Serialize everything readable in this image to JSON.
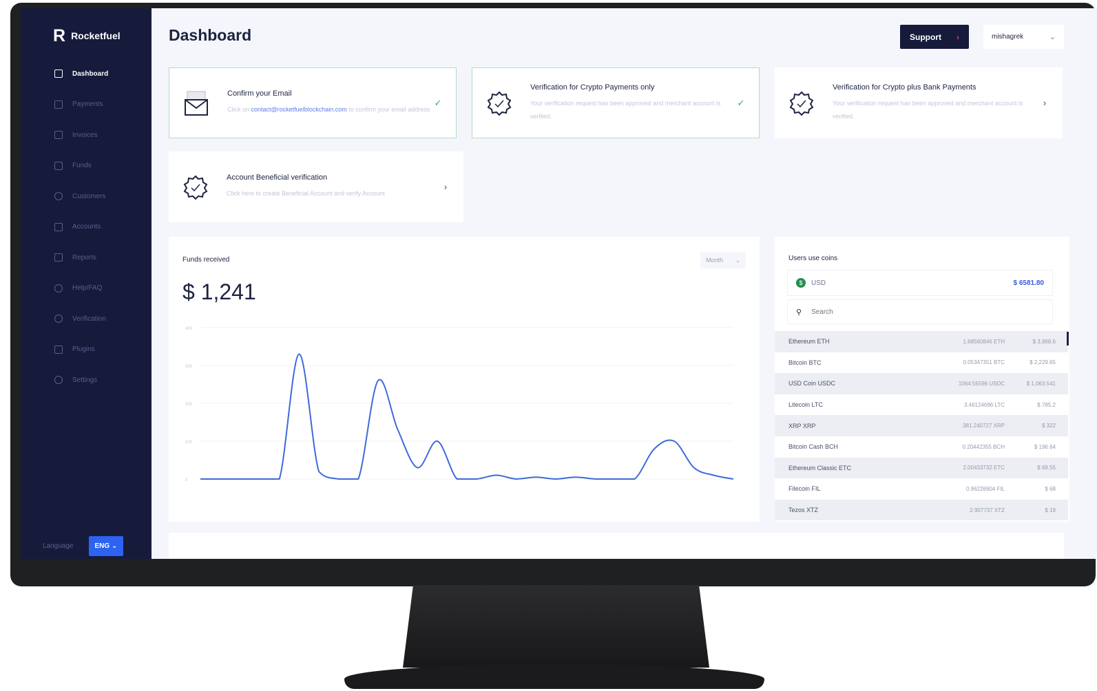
{
  "brand": {
    "name": "Rocketfuel",
    "mark": "R"
  },
  "sidebar": {
    "items": [
      {
        "label": "Dashboard",
        "icon": "grid-icon",
        "active": true
      },
      {
        "label": "Payments",
        "icon": "payments-icon",
        "active": false
      },
      {
        "label": "Invoices",
        "icon": "invoices-icon",
        "active": false
      },
      {
        "label": "Funds",
        "icon": "funds-icon",
        "active": false
      },
      {
        "label": "Customers",
        "icon": "customers-icon",
        "active": false
      },
      {
        "label": "Accounts",
        "icon": "accounts-icon",
        "active": false
      },
      {
        "label": "Reports",
        "icon": "reports-icon",
        "active": false
      },
      {
        "label": "Help/FAQ",
        "icon": "help-icon",
        "active": false
      },
      {
        "label": "Verification",
        "icon": "verification-icon",
        "active": false
      },
      {
        "label": "Plugins",
        "icon": "plugins-icon",
        "active": false
      },
      {
        "label": "Settings",
        "icon": "gear-icon",
        "active": false
      }
    ],
    "language_label": "Language",
    "language_value": "ENG"
  },
  "header": {
    "title": "Dashboard",
    "support_label": "Support",
    "user_name": "mishagrek"
  },
  "verification_cards": [
    {
      "title": "Confirm your Email",
      "desc_prefix": "Click on ",
      "desc_link": "contact@rocketfuelblockchain.com",
      "desc_suffix": " to confirm your email address",
      "status": "check"
    },
    {
      "title": "Verification for Crypto Payments only",
      "desc": "Your verification request has been approved and merchant account is verified.",
      "status": "check"
    },
    {
      "title": "Verification for Crypto plus Bank Payments",
      "desc": "Your verification request has been approved and merchant account is verified.",
      "status": "next"
    },
    {
      "title": "Account Beneficial verification",
      "desc": "Click here to create Beneficial Account and verify Account",
      "status": "next"
    }
  ],
  "funds": {
    "title": "Funds received",
    "period": "Month",
    "total": "$ 1,241"
  },
  "coins_panel": {
    "title": "Users use coins",
    "usd_label": "USD",
    "usd_value": "$ 6581.80",
    "search_placeholder": "Search",
    "rows": [
      {
        "name": "Ethereum ETH",
        "amount": "1.68560846 ETH",
        "usd": "$ 3,968.6"
      },
      {
        "name": "Bitcoin BTC",
        "amount": "0.05347351 BTC",
        "usd": "$ 2,229.65"
      },
      {
        "name": "USD Coin USDC",
        "amount": "1064.55596 USDC",
        "usd": "$ 1,063.541"
      },
      {
        "name": "Litecoin LTC",
        "amount": "3.46124696 LTC",
        "usd": "$ 785.2"
      },
      {
        "name": "XRP XRP",
        "amount": "381.240727 XRP",
        "usd": "$ 322"
      },
      {
        "name": "Bitcoin Cash BCH",
        "amount": "0.20442355 BCH",
        "usd": "$ 196.64"
      },
      {
        "name": "Ethereum Classic ETC",
        "amount": "2.00433732 ETC",
        "usd": "$ 69.55"
      },
      {
        "name": "Filecoin FIL",
        "amount": "0.96226904 FIL",
        "usd": "$ 68"
      },
      {
        "name": "Tezos XTZ",
        "amount": "2.907737 XTZ",
        "usd": "$ 18"
      }
    ]
  },
  "chart_data": {
    "type": "line",
    "title": "Funds received",
    "ylim": [
      0,
      400
    ],
    "yticks": [
      "0",
      "100",
      "200",
      "300",
      "400"
    ],
    "xticks": [
      "",
      "",
      "",
      "",
      "",
      "",
      "",
      "",
      "",
      "",
      ""
    ],
    "series": [
      {
        "values": [
          0,
          0,
          0,
          0,
          0,
          330,
          20,
          0,
          0,
          260,
          130,
          30,
          100,
          0,
          0,
          10,
          0,
          5,
          0,
          5,
          0,
          0,
          0,
          80,
          100,
          30,
          10,
          0
        ]
      }
    ]
  },
  "colors": {
    "sidebar": "#161a3b",
    "accent": "#2d63f0",
    "line": "#3d6ad9",
    "success": "#3aa179"
  }
}
